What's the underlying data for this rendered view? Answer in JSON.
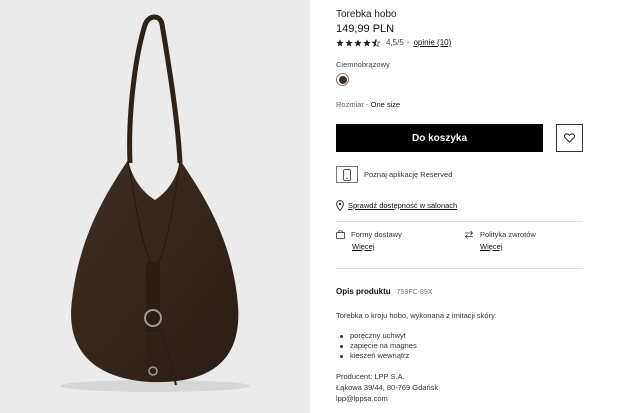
{
  "product": {
    "title": "Torebka hobo",
    "price": "149,99 PLN",
    "rating_value": "4,5/5",
    "rating_stars": 4.5,
    "rating_separator": "-",
    "reviews_link": "opinie (10)"
  },
  "color": {
    "label": "Ciemnobrązowy",
    "swatch_hex": "#4a2e26"
  },
  "size": {
    "label": "Rozmiar -",
    "value": "One size"
  },
  "actions": {
    "add_to_cart": "Do koszyka",
    "wishlist_icon": "heart-icon"
  },
  "app_promo": {
    "text": "Poznaj aplikację Reserved",
    "icon": "phone-icon"
  },
  "availability": {
    "link": "Sprawdź dostępność w salonach",
    "icon": "location-pin-icon"
  },
  "services": [
    {
      "title": "Formy dostawy",
      "more": "Więcej",
      "icon": "shopping-bag-icon"
    },
    {
      "title": "Polityka zwrotów",
      "more": "Więcej",
      "icon": "return-arrows-icon"
    }
  ],
  "description": {
    "title": "Opis produktu",
    "code": "759FC-89X",
    "text": "Torebka o kroju hobo, wykonana z imitacji skóry.",
    "features": [
      "poręczny uchwyt",
      "zapięcie na magnes",
      "kieszeń wewnątrz"
    ],
    "producer": [
      "Producent: LPP S.A.",
      "Łąkowa 39/44, 80-769 Gdańsk",
      "lpp@lppsa.com"
    ]
  },
  "colors": {
    "primary": "#000000",
    "photo_background": "#ebebeb",
    "bag": "#3a2a20",
    "star": "#222222"
  }
}
